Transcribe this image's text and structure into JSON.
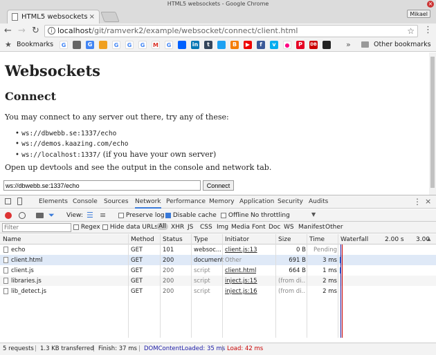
{
  "window": {
    "title": "HTML5 websockets - Google Chrome",
    "profile": "Mikael"
  },
  "tab": {
    "title": "HTML5 websockets"
  },
  "address": {
    "host": "localhost",
    "path": "/git/ramverk2/example/websocket/connect/client.html"
  },
  "bookmarks": {
    "label": "Bookmarks",
    "other": "Other bookmarks",
    "overflow": "»"
  },
  "page": {
    "h1": "Websockets",
    "h2": "Connect",
    "intro": "You may connect to any server out there, try any of these:",
    "servers": [
      "ws://dbwebb.se:1337/echo",
      "ws://demos.kaazing.com/echo",
      "ws://localhost:1337/"
    ],
    "own_server_note": "(if you have your own server)",
    "devtools_hint": "Open up devtools and see the output in the console and network tab.",
    "input_value": "ws://dbwebb.se:1337/echo",
    "connect_label": "Connect"
  },
  "devtools": {
    "tabs": [
      "Elements",
      "Console",
      "Sources",
      "Network",
      "Performance",
      "Memory",
      "Application",
      "Security",
      "Audits"
    ],
    "active_tab": "Network",
    "toolbar": {
      "view": "View:",
      "preserve_log": "Preserve log",
      "disable_cache": "Disable cache",
      "offline": "Offline",
      "throttling": "No throttling"
    },
    "filter": {
      "placeholder": "Filter",
      "regex": "Regex",
      "hide_data_urls": "Hide data URLs",
      "types": [
        "All",
        "XHR",
        "JS",
        "CSS",
        "Img",
        "Media",
        "Font",
        "Doc",
        "WS",
        "Manifest",
        "Other"
      ]
    },
    "columns": [
      "Name",
      "Method",
      "Status",
      "Type",
      "Initiator",
      "Size",
      "Time",
      "Waterfall"
    ],
    "waterfall_ticks": [
      "2.00 s",
      "3.00"
    ],
    "rows": [
      {
        "name": "echo",
        "method": "GET",
        "status": "101",
        "type": "websoc...",
        "initiator": "client.js:13",
        "size": "0 B",
        "time": "Pending"
      },
      {
        "name": "client.html",
        "method": "GET",
        "status": "200",
        "type": "document",
        "initiator": "Other",
        "size": "691 B",
        "time": "3 ms"
      },
      {
        "name": "client.js",
        "method": "GET",
        "status": "200",
        "type": "script",
        "initiator": "client.html",
        "size": "664 B",
        "time": "1 ms"
      },
      {
        "name": "libraries.js",
        "method": "GET",
        "status": "200",
        "type": "script",
        "initiator": "inject.js:15",
        "size": "(from di...",
        "time": "2 ms"
      },
      {
        "name": "lib_detect.js",
        "method": "GET",
        "status": "200",
        "type": "script",
        "initiator": "inject.js:16",
        "size": "(from di...",
        "time": "2 ms"
      }
    ],
    "status_bar": {
      "requests": "5 requests",
      "transferred": "1.3 KB transferred",
      "finish": "Finish: 37 ms",
      "dcl": "DOMContentLoaded: 35 ms",
      "load": "Load: 42 ms"
    }
  },
  "colors": {
    "accent": "#3879d9",
    "dcl": "#1a1aa6",
    "load": "#c80000"
  }
}
